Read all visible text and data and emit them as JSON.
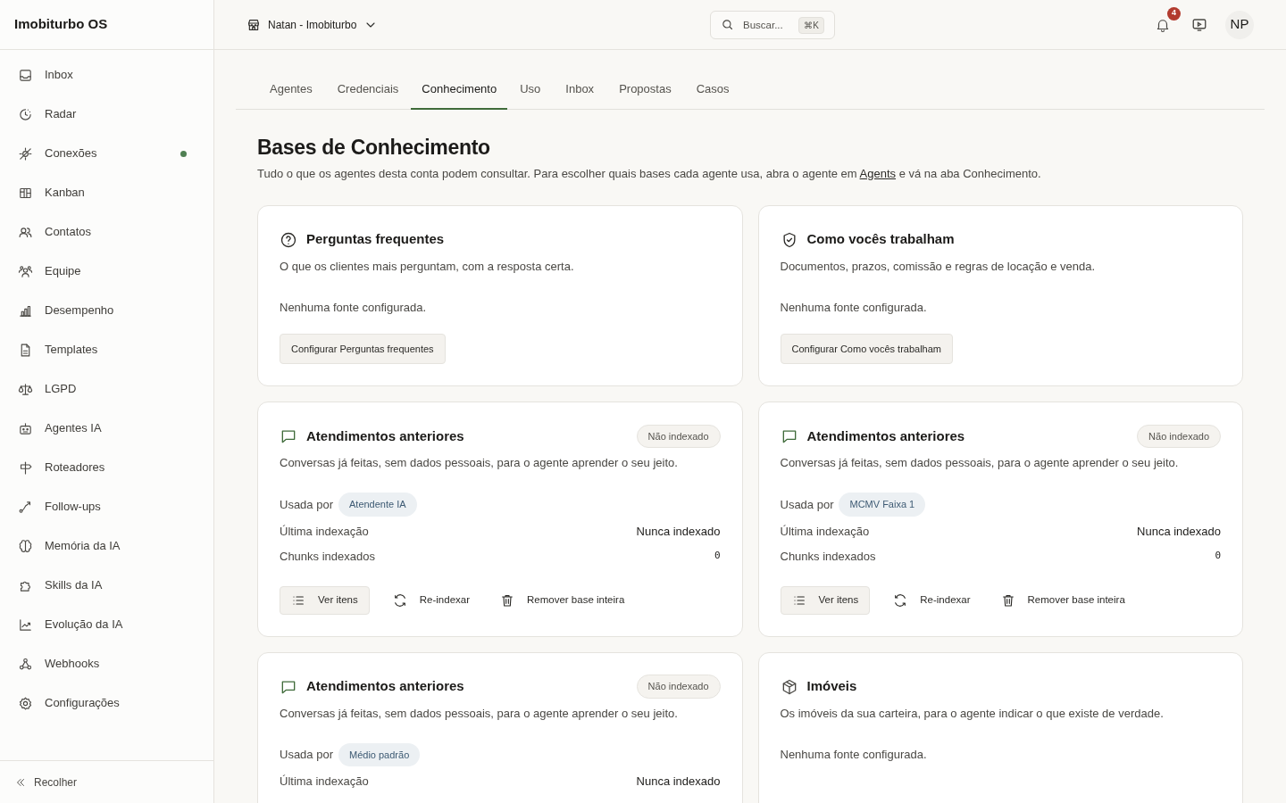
{
  "app": {
    "title": "Imobiturbo OS"
  },
  "sidebar": {
    "items": [
      {
        "label": "Inbox",
        "dot": false
      },
      {
        "label": "Radar",
        "dot": false
      },
      {
        "label": "Conexões",
        "dot": true
      },
      {
        "label": "Kanban",
        "dot": false
      },
      {
        "label": "Contatos",
        "dot": false
      },
      {
        "label": "Equipe",
        "dot": false
      },
      {
        "label": "Desempenho",
        "dot": false
      },
      {
        "label": "Templates",
        "dot": false
      },
      {
        "label": "LGPD",
        "dot": false
      },
      {
        "label": "Agentes IA",
        "dot": false
      },
      {
        "label": "Roteadores",
        "dot": false
      },
      {
        "label": "Follow-ups",
        "dot": false
      },
      {
        "label": "Memória da IA",
        "dot": false
      },
      {
        "label": "Skills da IA",
        "dot": false
      },
      {
        "label": "Evolução da IA",
        "dot": false
      },
      {
        "label": "Webhooks",
        "dot": false
      },
      {
        "label": "Configurações",
        "dot": false
      }
    ],
    "collapse": "Recolher"
  },
  "header": {
    "workspace": "Natan - Imobiturbo",
    "search": {
      "placeholder": "Buscar...",
      "shortcut": "⌘K"
    },
    "notifications": "4",
    "avatar": "NP"
  },
  "tabs": [
    {
      "label": "Agentes",
      "selected": false
    },
    {
      "label": "Credenciais",
      "selected": false
    },
    {
      "label": "Conhecimento",
      "selected": true
    },
    {
      "label": "Uso",
      "selected": false
    },
    {
      "label": "Inbox",
      "selected": false
    },
    {
      "label": "Propostas",
      "selected": false
    },
    {
      "label": "Casos",
      "selected": false
    }
  ],
  "page": {
    "title": "Bases de Conhecimento",
    "description_before": "Tudo o que os agentes desta conta podem consultar. Para escolher quais bases cada agente usa, abra o agente em ",
    "link": "Agents",
    "description_after": " e vá na aba Conhecimento."
  },
  "cards": [
    {
      "kind": "empty",
      "title": "Perguntas frequentes",
      "description": "O que os clientes mais perguntam, com a resposta certa.",
      "empty_text": "Nenhuma fonte configurada.",
      "button": "Configurar Perguntas frequentes"
    },
    {
      "kind": "empty",
      "title": "Como vocês trabalham",
      "description": "Documentos, prazos, comissão e regras de locação e venda.",
      "empty_text": "Nenhuma fonte configurada.",
      "button": "Configurar Como vocês trabalham"
    },
    {
      "kind": "indexed",
      "title": "Atendimentos anteriores",
      "description": "Conversas já feitas, sem dados pessoais, para o agente aprender o seu jeito.",
      "status": "Não indexado",
      "used_by_label": "Usada por",
      "used_by": "Atendente IA",
      "rows": [
        {
          "kind": "text",
          "label": "Última indexação",
          "value": "Nunca indexado"
        },
        {
          "kind": "number",
          "label": "Chunks indexados",
          "value": "0"
        }
      ],
      "actions": [
        "Ver itens",
        "Re-indexar",
        "Remover base inteira"
      ]
    },
    {
      "kind": "indexed",
      "title": "Atendimentos anteriores",
      "description": "Conversas já feitas, sem dados pessoais, para o agente aprender o seu jeito.",
      "status": "Não indexado",
      "used_by_label": "Usada por",
      "used_by": "MCMV Faixa 1",
      "rows": [
        {
          "kind": "text",
          "label": "Última indexação",
          "value": "Nunca indexado"
        },
        {
          "kind": "number",
          "label": "Chunks indexados",
          "value": "0"
        }
      ],
      "actions": [
        "Ver itens",
        "Re-indexar",
        "Remover base inteira"
      ]
    },
    {
      "kind": "indexed",
      "title": "Atendimentos anteriores",
      "description": "Conversas já feitas, sem dados pessoais, para o agente aprender o seu jeito.",
      "status": "Não indexado",
      "used_by_label": "Usada por",
      "used_by": "Médio padrão",
      "rows": [
        {
          "kind": "text",
          "label": "Última indexação",
          "value": "Nunca indexado"
        }
      ]
    },
    {
      "kind": "empty",
      "title": "Imóveis",
      "description": "Os imóveis da sua carteira, para o agente indicar o que existe de verdade.",
      "empty_text": "Nenhuma fonte configurada."
    }
  ]
}
